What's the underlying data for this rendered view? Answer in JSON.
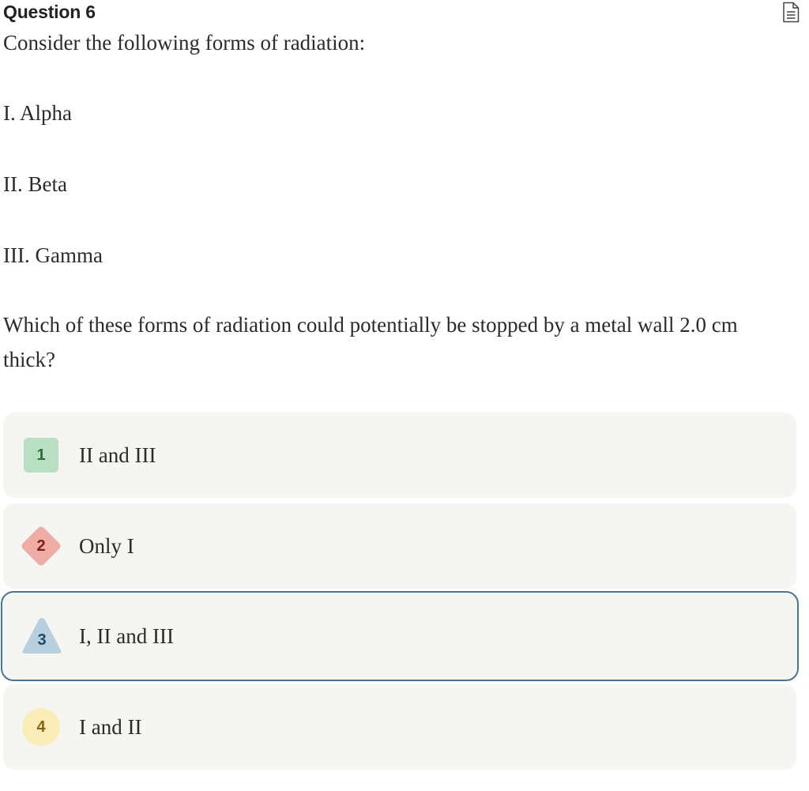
{
  "question": {
    "title": "Question 6",
    "icon": "document-icon",
    "intro": "Consider the following forms of radiation:",
    "items": [
      "I. Alpha",
      "II. Beta",
      "III. Gamma"
    ],
    "prompt": "Which of these forms of radiation could potentially be stopped by a metal wall 2.0 cm thick?"
  },
  "options": [
    {
      "number": "1",
      "label": "II and III",
      "shape": "square",
      "color": "#b9dfc2",
      "text_color": "#2e6b3a",
      "selected": false
    },
    {
      "number": "2",
      "label": "Only I",
      "shape": "diamond",
      "color": "#efaca4",
      "text_color": "#7a1f1a",
      "selected": false
    },
    {
      "number": "3",
      "label": "I, II and III",
      "shape": "triangle",
      "color": "#b8cfe0",
      "text_color": "#1f4766",
      "selected": true
    },
    {
      "number": "4",
      "label": "I and II",
      "shape": "circle",
      "color": "#fbedb8",
      "text_color": "#8a6214",
      "selected": false
    }
  ],
  "colors": {
    "option_background": "#f5f5f2",
    "selected_border": "#4a7593"
  }
}
